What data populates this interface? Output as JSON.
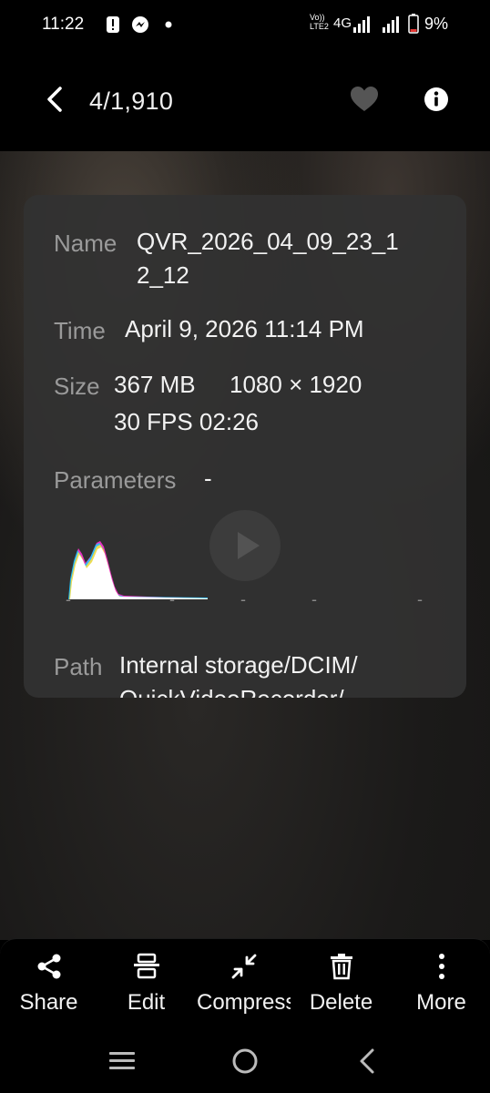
{
  "status_bar": {
    "time": "11:22",
    "network": "Vo)) LTE2",
    "network_type": "4G",
    "battery": "9%",
    "icons": [
      "alert-icon",
      "messenger-icon",
      "dot-icon",
      "signal-icon",
      "signal-icon",
      "battery-icon"
    ]
  },
  "header": {
    "counter": "4/1,910",
    "icons": [
      "back-arrow-icon",
      "heart-icon",
      "info-icon"
    ]
  },
  "details": {
    "name_label": "Name",
    "name_line1": "QVR_2026_04_09_23_1",
    "name_line2": "2_12",
    "time_label": "Time",
    "time_value": "April 9, 2026 11:14 PM",
    "size_label": "Size",
    "size_line1_a": "367 MB",
    "size_line1_b": "1080 × 1920",
    "size_line2": "30 FPS 02:26",
    "parameters_label": "Parameters",
    "parameters_value": "-",
    "histogram_dashes": [
      "-",
      "-",
      "-",
      "-",
      "-"
    ],
    "path_label": "Path",
    "path_line1": "Internal storage/DCIM/",
    "path_line2": "QuickVideoRecorder/"
  },
  "toolbar": {
    "items": [
      {
        "label": "Share",
        "icon": "share-icon"
      },
      {
        "label": "Edit",
        "icon": "edit-icon"
      },
      {
        "label": "Compress",
        "icon": "compress-icon"
      },
      {
        "label": "Delete",
        "icon": "delete-icon"
      },
      {
        "label": "More",
        "icon": "more-icon"
      }
    ]
  },
  "nav_bar": {
    "icons": [
      "recent-apps-icon",
      "home-icon",
      "back-icon"
    ]
  },
  "colors": {
    "background": "#000000",
    "card": "#323232",
    "label": "#9a9a9a",
    "text": "#f2f2f2",
    "battery_low": "#e53935"
  }
}
